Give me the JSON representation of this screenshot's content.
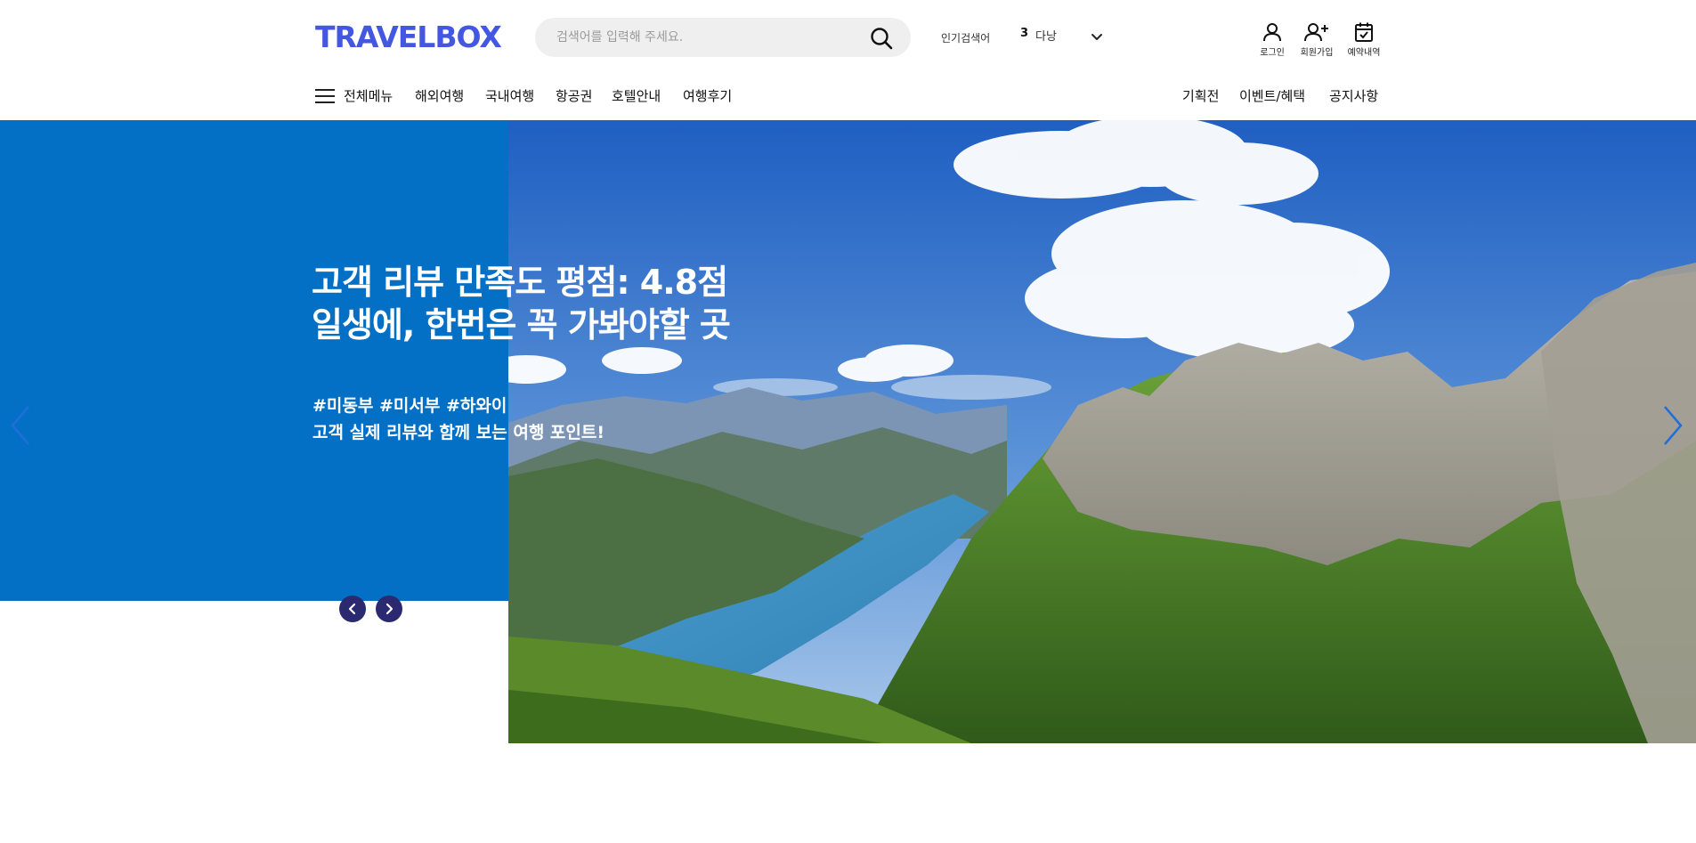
{
  "header": {
    "logo": "TRAVELBOX",
    "search": {
      "placeholder": "검색어를 입력해 주세요.",
      "value": ""
    },
    "popular": {
      "label": "인기검색어",
      "rank": "3",
      "word": "다낭"
    },
    "util": {
      "login": "로그인",
      "signup": "회원가입",
      "reservations": "예약내역"
    }
  },
  "nav": {
    "all_menu": "전체메뉴",
    "items": [
      "해외여행",
      "국내여행",
      "항공권",
      "호텔안내",
      "여행후기"
    ],
    "right_items": [
      "기획전",
      "이벤트/혜택",
      "공지사항"
    ]
  },
  "hero": {
    "title_line1": "고객 리뷰 만족도 평점: 4.8점",
    "title_line2": "일생에, 한번은 꼭 가봐야할 곳",
    "tags": "#미동부 #미서부 #하와이",
    "subtitle": "고객 실제 리뷰와 함께 보는 여행 포인트!",
    "colors": {
      "panel": "#0370c5",
      "nav_button": "#2b2970",
      "logo": "#4457e0"
    }
  },
  "icons": [
    "search-icon",
    "chevron-down-icon",
    "user-icon",
    "user-plus-icon",
    "calendar-check-icon",
    "hamburger-icon",
    "chevron-left-icon",
    "chevron-right-icon"
  ]
}
